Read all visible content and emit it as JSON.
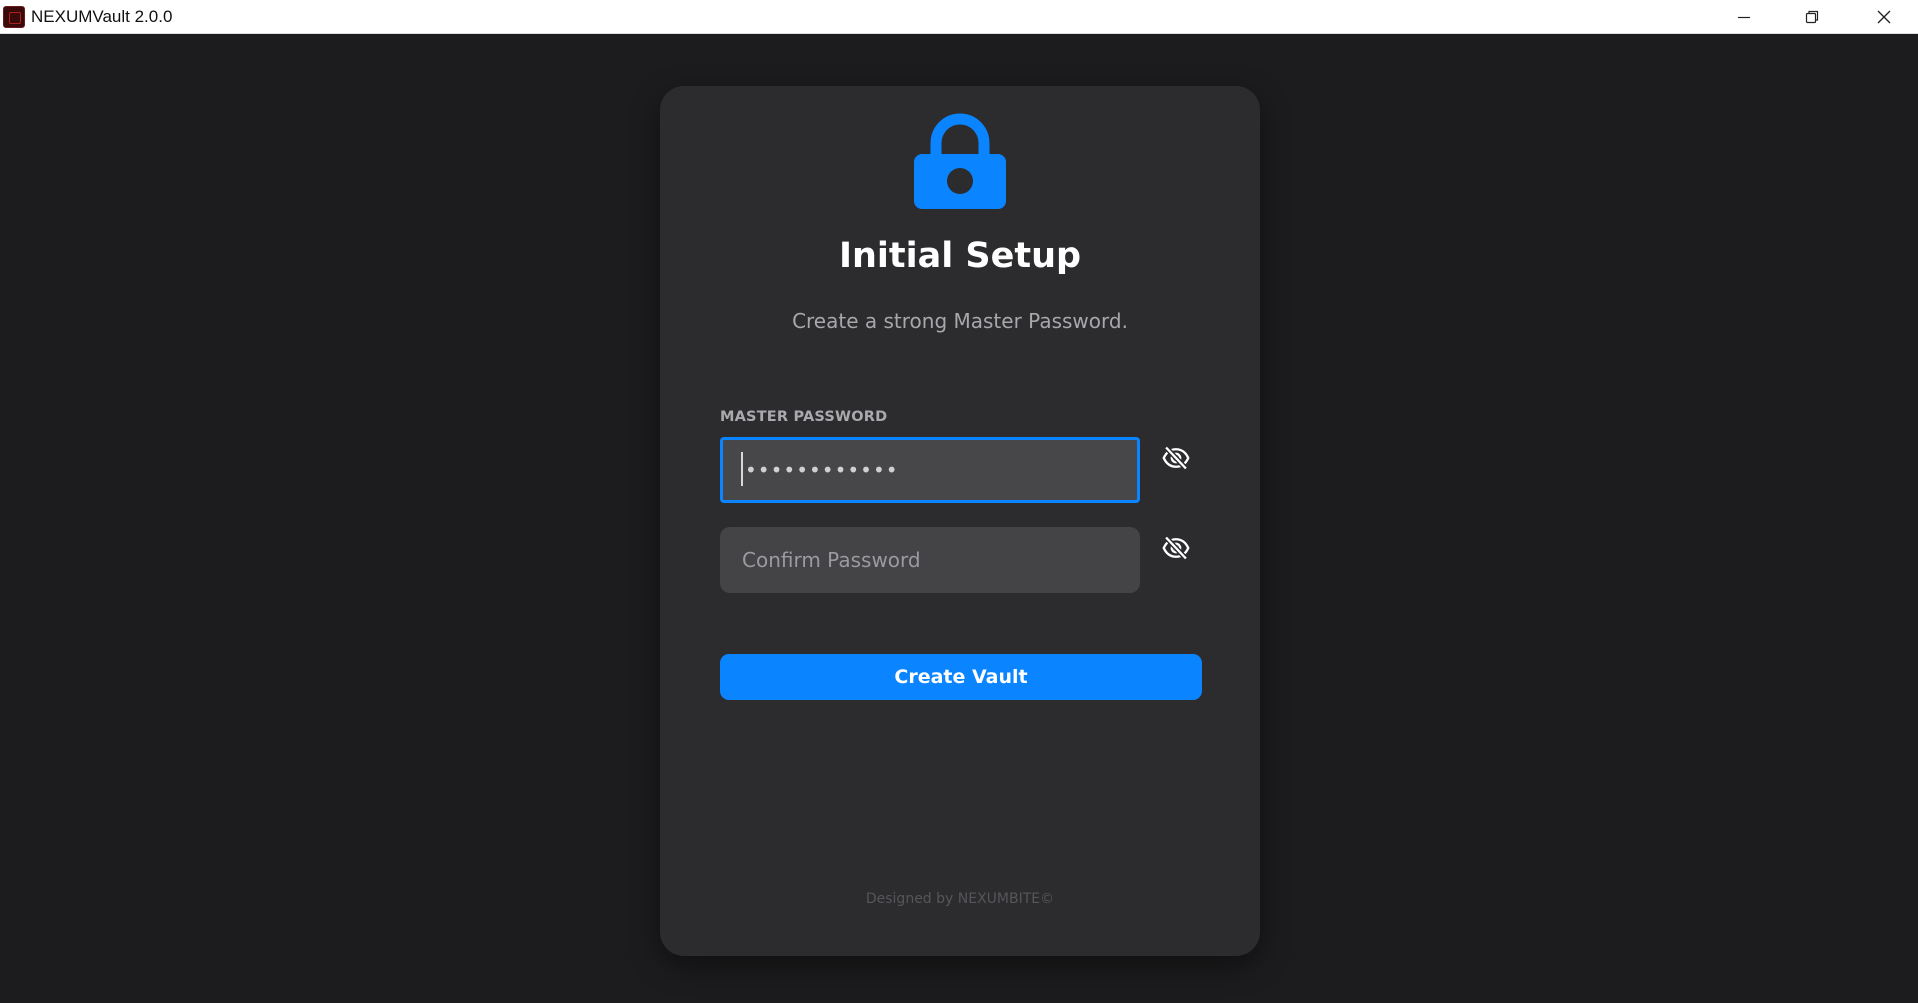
{
  "window": {
    "title": "NEXUMVault 2.0.0",
    "app_icon": "nexumvault-app-icon",
    "controls": [
      "minimize-icon",
      "restore-icon",
      "close-icon"
    ]
  },
  "setup": {
    "lock_icon": "lock-icon",
    "title": "Initial Setup",
    "subtitle": "Create a strong Master Password.",
    "master_label": "MASTER PASSWORD",
    "master_value": "••••••••••••",
    "master_placeholder": "",
    "confirm_value": "",
    "confirm_placeholder": "Confirm Password",
    "toggle_icon": "eye-off-icon",
    "create_button": "Create Vault",
    "footer": "Designed by NEXUMBITE©"
  },
  "colors": {
    "accent": "#0a84ff",
    "window_bg": "#1c1c1e",
    "card_bg": "#2c2c2e",
    "input_bg": "#444446"
  }
}
